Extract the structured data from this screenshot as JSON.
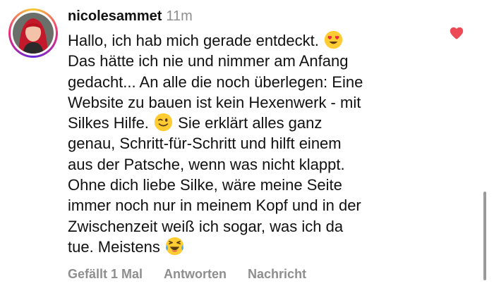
{
  "comment": {
    "username": "nicolesammet",
    "timestamp": "11m",
    "lines": [
      "Hallo, ich hab mich gerade entdeckt.",
      "Das hätte ich nie und nimmer am Anfang",
      "gedacht... An alle die noch überlegen: Eine",
      "Website zu bauen ist kein Hexenwerk - mit",
      "Silkes Hilfe.",
      "Sie erklärt alles ganz",
      "genau, Schritt-für-Schritt und hilft einem",
      "aus der Patsche, wenn was nicht klappt.",
      "Ohne dich liebe Silke, wäre meine Seite",
      "immer noch nur in meinem Kopf und in der",
      "Zwischenzeit weiß ich sogar, was ich da",
      "tue. Meistens"
    ],
    "emojis": [
      "heart-eyes-emoji",
      "winking-face-emoji",
      "laughing-tears-emoji"
    ],
    "liked": true,
    "actions": {
      "likes": "Gefällt 1 Mal",
      "reply": "Antworten",
      "message": "Nachricht"
    }
  },
  "colors": {
    "text": "#111111",
    "muted": "#8e8e8e",
    "heart": "#ed4956",
    "emoji_face": "#FFCC33"
  }
}
